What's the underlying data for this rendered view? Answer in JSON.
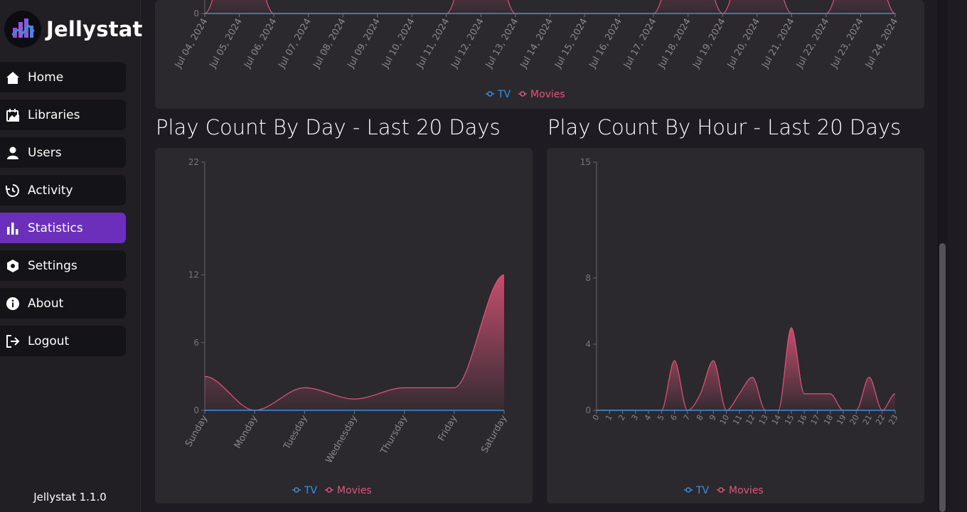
{
  "app": {
    "name": "Jellystat",
    "version": "Jellystat 1.1.0"
  },
  "nav": [
    {
      "label": "Home",
      "icon": "home-icon",
      "active": false
    },
    {
      "label": "Libraries",
      "icon": "libraries-icon",
      "active": false
    },
    {
      "label": "Users",
      "icon": "user-icon",
      "active": false
    },
    {
      "label": "Activity",
      "icon": "history-icon",
      "active": false
    },
    {
      "label": "Statistics",
      "icon": "bar-chart-icon",
      "active": true
    },
    {
      "label": "Settings",
      "icon": "settings-icon",
      "active": false
    },
    {
      "label": "About",
      "icon": "info-icon",
      "active": false
    },
    {
      "label": "Logout",
      "icon": "logout-icon",
      "active": false
    }
  ],
  "colors": {
    "accent": "#6b2fbb",
    "tv": "#3a8fdd",
    "movies": "#e0557a",
    "card": "#2b292e"
  },
  "chart_data": [
    {
      "id": "daily",
      "type": "area",
      "title": "",
      "categories": [
        "Jul 04, 2024",
        "Jul 05, 2024",
        "Jul 06, 2024",
        "Jul 07, 2024",
        "Jul 08, 2024",
        "Jul 09, 2024",
        "Jul 10, 2024",
        "Jul 11, 2024",
        "Jul 12, 2024",
        "Jul 13, 2024",
        "Jul 14, 2024",
        "Jul 15, 2024",
        "Jul 16, 2024",
        "Jul 17, 2024",
        "Jul 18, 2024",
        "Jul 19, 2024",
        "Jul 20, 2024",
        "Jul 21, 2024",
        "Jul 22, 2024",
        "Jul 23, 2024",
        "Jul 24, 2024"
      ],
      "yticks": [
        0
      ],
      "legend": "bottom-center",
      "series": [
        {
          "name": "TV",
          "values": [
            0,
            0,
            0,
            0,
            0,
            0,
            0,
            0,
            0,
            0,
            0,
            0,
            0,
            0,
            0,
            0,
            0,
            0,
            0,
            0,
            0
          ]
        },
        {
          "name": "Movies",
          "values": [
            0,
            2,
            0,
            0,
            0,
            0,
            0,
            0,
            2,
            0,
            0,
            0,
            0,
            0,
            2,
            0,
            2,
            0,
            0,
            2,
            0
          ]
        }
      ]
    },
    {
      "id": "byday",
      "type": "area",
      "title": "Play Count By Day - Last 20 Days",
      "categories": [
        "Sunday",
        "Monday",
        "Tuesday",
        "Wednesday",
        "Thursday",
        "Friday",
        "Saturday"
      ],
      "ylim": [
        0,
        22
      ],
      "yticks": [
        0,
        6,
        12,
        22
      ],
      "legend": "bottom-center",
      "series": [
        {
          "name": "TV",
          "values": [
            0,
            0,
            0,
            0,
            0,
            0,
            0
          ]
        },
        {
          "name": "Movies",
          "values": [
            3,
            0,
            2,
            1,
            2,
            2,
            12
          ]
        }
      ]
    },
    {
      "id": "byhour",
      "type": "area",
      "title": "Play Count By Hour - Last 20 Days",
      "categories": [
        "0",
        "1",
        "2",
        "3",
        "4",
        "5",
        "6",
        "7",
        "8",
        "9",
        "10",
        "11",
        "12",
        "13",
        "14",
        "15",
        "16",
        "17",
        "18",
        "19",
        "20",
        "21",
        "22",
        "23"
      ],
      "ylim": [
        0,
        15
      ],
      "yticks": [
        0,
        4,
        8,
        15
      ],
      "legend": "bottom-center",
      "series": [
        {
          "name": "TV",
          "values": [
            0,
            0,
            0,
            0,
            0,
            0,
            0,
            0,
            0,
            0,
            0,
            0,
            0,
            0,
            0,
            0,
            0,
            0,
            0,
            0,
            0,
            0,
            0,
            0
          ]
        },
        {
          "name": "Movies",
          "values": [
            0,
            0,
            0,
            0,
            0,
            0,
            3,
            0,
            1,
            3,
            0,
            1,
            2,
            0,
            0,
            5,
            1,
            1,
            1,
            0,
            0,
            2,
            0,
            1
          ]
        }
      ]
    }
  ]
}
